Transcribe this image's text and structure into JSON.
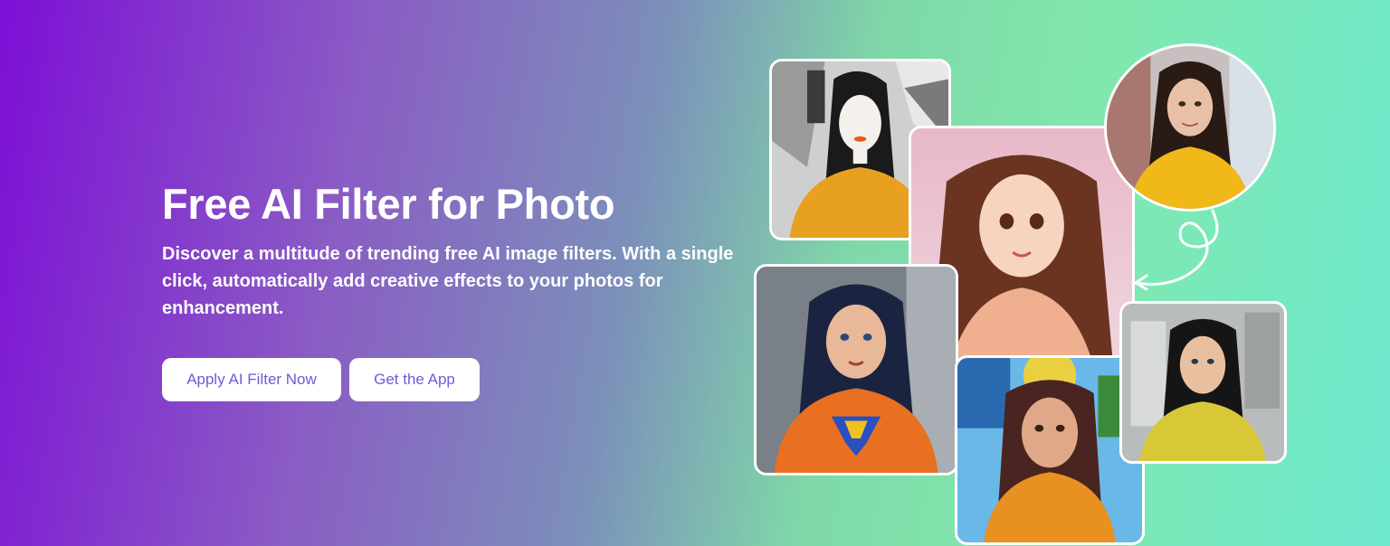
{
  "hero": {
    "title": "Free AI Filter for Photo",
    "description": "Discover a multitude of trending free AI image filters. With a single click, automatically add creative effects to your photos for enhancement."
  },
  "buttons": {
    "apply_label": "Apply AI Filter Now",
    "app_label": "Get the App"
  },
  "colors": {
    "button_text": "#6f5bd6",
    "gradient_start": "#7d0fd6",
    "gradient_end": "#6ee8cf"
  },
  "gallery": {
    "images": [
      "grayscale-abstract-portrait",
      "anime-style-portrait",
      "superhero-comic-portrait",
      "pixel-art-portrait",
      "grayscale-sketch-portrait",
      "original-photo-portrait"
    ]
  }
}
